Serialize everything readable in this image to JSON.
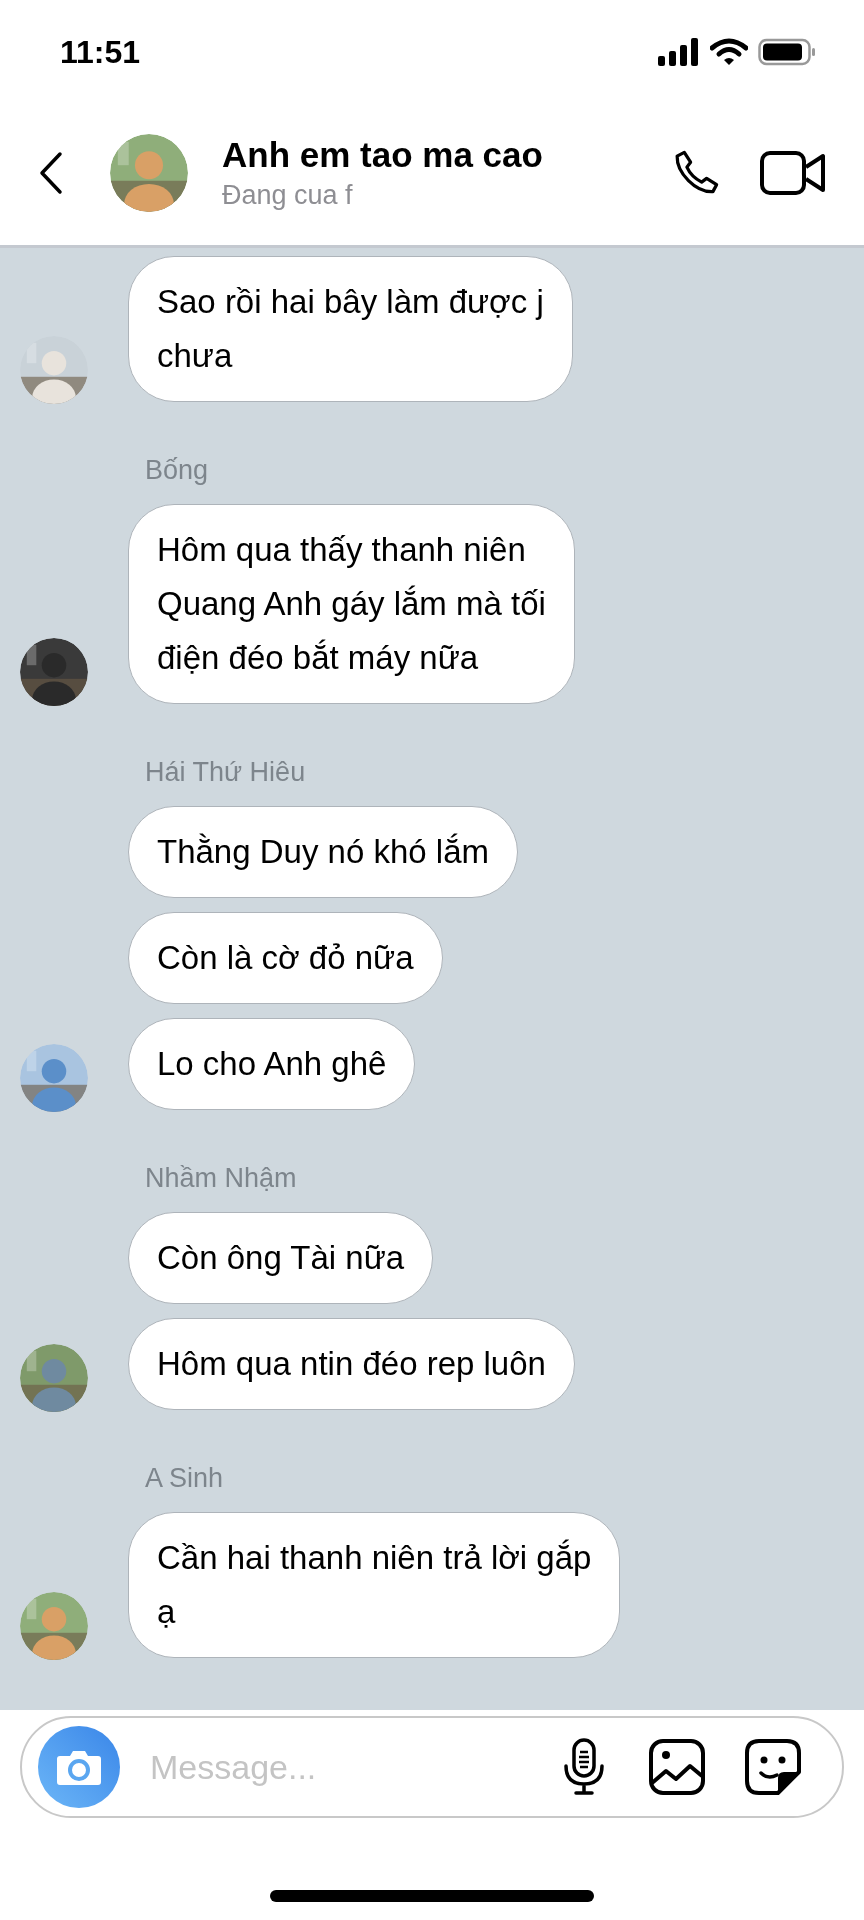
{
  "status_bar": {
    "time": "11:51"
  },
  "header": {
    "title": "Anh em tao ma cao",
    "subtitle": "Đang cua f"
  },
  "groups": [
    {
      "messages": [
        {
          "lines": [
            "Sao rồi hai bây làm được j",
            "chưa"
          ]
        }
      ]
    },
    {
      "sender": "Bống",
      "messages": [
        {
          "lines": [
            "Hôm qua thấy thanh niên",
            "Quang Anh gáy lắm mà tối",
            "điện đéo bắt máy nữa"
          ]
        }
      ]
    },
    {
      "sender": "Hái Thứ Hiêu",
      "messages": [
        {
          "lines": [
            "Thằng Duy nó khó lắm"
          ]
        },
        {
          "lines": [
            "Còn là cờ đỏ nữa"
          ]
        },
        {
          "lines": [
            "Lo cho Anh ghê"
          ]
        }
      ]
    },
    {
      "sender": "Nhầm Nhậm",
      "messages": [
        {
          "lines": [
            "Còn ông Tài nữa"
          ]
        },
        {
          "lines": [
            "Hôm qua ntin đéo rep luôn"
          ]
        }
      ]
    },
    {
      "sender": "A Sinh",
      "messages": [
        {
          "lines": [
            "Cần hai thanh niên trả lời gắp",
            "ạ"
          ]
        }
      ]
    }
  ],
  "composer": {
    "placeholder": "Message..."
  }
}
